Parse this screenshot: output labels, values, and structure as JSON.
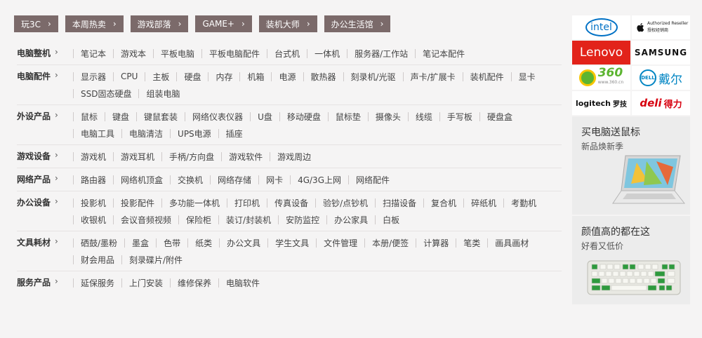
{
  "channels": [
    "玩3C",
    "本周热卖",
    "游戏部落",
    "GAME+",
    "装机大师",
    "办公生活馆"
  ],
  "categories": [
    {
      "title": "电脑整机",
      "items": [
        "笔记本",
        "游戏本",
        "平板电脑",
        "平板电脑配件",
        "台式机",
        "一体机",
        "服务器/工作站",
        "笔记本配件"
      ]
    },
    {
      "title": "电脑配件",
      "items": [
        "显示器",
        "CPU",
        "主板",
        "硬盘",
        "内存",
        "机箱",
        "电源",
        "散热器",
        "刻录机/光驱",
        "声卡/扩展卡",
        "装机配件",
        "显卡",
        "SSD固态硬盘",
        "组装电脑"
      ]
    },
    {
      "title": "外设产品",
      "items": [
        "鼠标",
        "键盘",
        "键鼠套装",
        "网络仪表仪器",
        "U盘",
        "移动硬盘",
        "鼠标垫",
        "摄像头",
        "线缆",
        "手写板",
        "硬盘盒",
        "电脑工具",
        "电脑清洁",
        "UPS电源",
        "插座"
      ]
    },
    {
      "title": "游戏设备",
      "items": [
        "游戏机",
        "游戏耳机",
        "手柄/方向盘",
        "游戏软件",
        "游戏周边"
      ]
    },
    {
      "title": "网络产品",
      "items": [
        "路由器",
        "网络机顶盒",
        "交换机",
        "网络存储",
        "网卡",
        "4G/3G上网",
        "网络配件"
      ]
    },
    {
      "title": "办公设备",
      "items": [
        "投影机",
        "投影配件",
        "多功能一体机",
        "打印机",
        "传真设备",
        "验钞/点钞机",
        "扫描设备",
        "复合机",
        "碎纸机",
        "考勤机",
        "收银机",
        "会议音频视频",
        "保险柜",
        "装订/封装机",
        "安防监控",
        "办公家具",
        "白板"
      ]
    },
    {
      "title": "文具耗材",
      "items": [
        "硒鼓/墨粉",
        "墨盒",
        "色带",
        "纸类",
        "办公文具",
        "学生文具",
        "文件管理",
        "本册/便签",
        "计算器",
        "笔类",
        "画具画材",
        "财会用品",
        "刻录碟片/附件"
      ]
    },
    {
      "title": "服务产品",
      "items": [
        "延保服务",
        "上门安装",
        "维修保养",
        "电脑软件"
      ]
    }
  ],
  "brands": {
    "intel": "intel",
    "apple_line1": "Authorized Reseller",
    "apple_line2": "授权经销商",
    "lenovo": "Lenovo",
    "samsung": "SAMSUNG",
    "q360": "360",
    "q360_sub": "www.360.cn",
    "dell": "DELL",
    "dell_cn": "戴尔",
    "logitech": "logitech",
    "logitech_cn": "罗技",
    "deli": "deli",
    "deli_cn": "得力"
  },
  "promos": [
    {
      "title": "买电脑送鼠标",
      "subtitle": "新品焕新季"
    },
    {
      "title": "颜值高的都在这",
      "subtitle": "好看又低价"
    }
  ],
  "icons": {
    "chevron": "chevron-right-icon"
  },
  "colors": {
    "channel_bg": "#7b6a6a",
    "page_bg": "#f5f4f4",
    "lenovo_red": "#e2231a",
    "intel_blue": "#0071c5",
    "q360_green": "#5cb531",
    "dell_blue": "#0085c3",
    "deli_red": "#d7000f"
  }
}
